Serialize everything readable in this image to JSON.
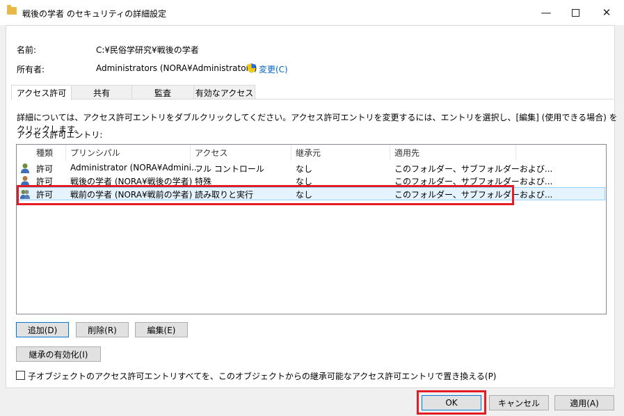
{
  "window": {
    "title": "戦後の学者 のセキュリティの詳細設定",
    "minimize": "—",
    "maximize": "☐",
    "close": "✕"
  },
  "info": {
    "name_label": "名前:",
    "name_value": "C:¥民俗学研究¥戦後の学者",
    "owner_label": "所有者:",
    "owner_value": "Administrators (NORA¥Administrators)",
    "change_link": "変更(C)"
  },
  "tabs": [
    {
      "label": "アクセス許可",
      "active": true
    },
    {
      "label": "共有",
      "active": false
    },
    {
      "label": "監査",
      "active": false
    },
    {
      "label": "有効なアクセス",
      "active": false
    }
  ],
  "instructions": "詳細については、アクセス許可エントリをダブルクリックしてください。アクセス許可エントリを変更するには、エントリを選択し、[編集] (使用できる場合) をクリックします。",
  "entries_label": "アクセス許可エントリ:",
  "table": {
    "headers": [
      "種類",
      "プリンシパル",
      "アクセス",
      "継承元",
      "適用先"
    ],
    "rows": [
      [
        "許可",
        "Administrator (NORA¥Admini...",
        "フル コントロール",
        "なし",
        "このフォルダー、サブフォルダーおよび..."
      ],
      [
        "許可",
        "戦後の学者 (NORA¥戦後の学者)",
        "特殊",
        "なし",
        "このフォルダー、サブフォルダーおよび..."
      ],
      [
        "許可",
        "戦前の学者 (NORA¥戦前の学者)",
        "読み取りと実行",
        "なし",
        "このフォルダー、サブフォルダーおよび..."
      ]
    ],
    "selected_row": 2
  },
  "buttons": {
    "add": "追加(D)",
    "delete": "削除(R)",
    "edit": "編集(E)",
    "enable_inheritance": "継承の有効化(I)",
    "ok": "OK",
    "cancel": "キャンセル",
    "apply": "適用(A)"
  },
  "replace_checkbox": {
    "label": "子オブジェクトのアクセス許可エントリすべてを、このオブジェクトからの継承可能なアクセス許可エントリで置き換える(P)",
    "checked": false
  },
  "colors": {
    "highlight": "#e31b23",
    "selection": "#e5f3ff",
    "link": "#0066cc"
  }
}
